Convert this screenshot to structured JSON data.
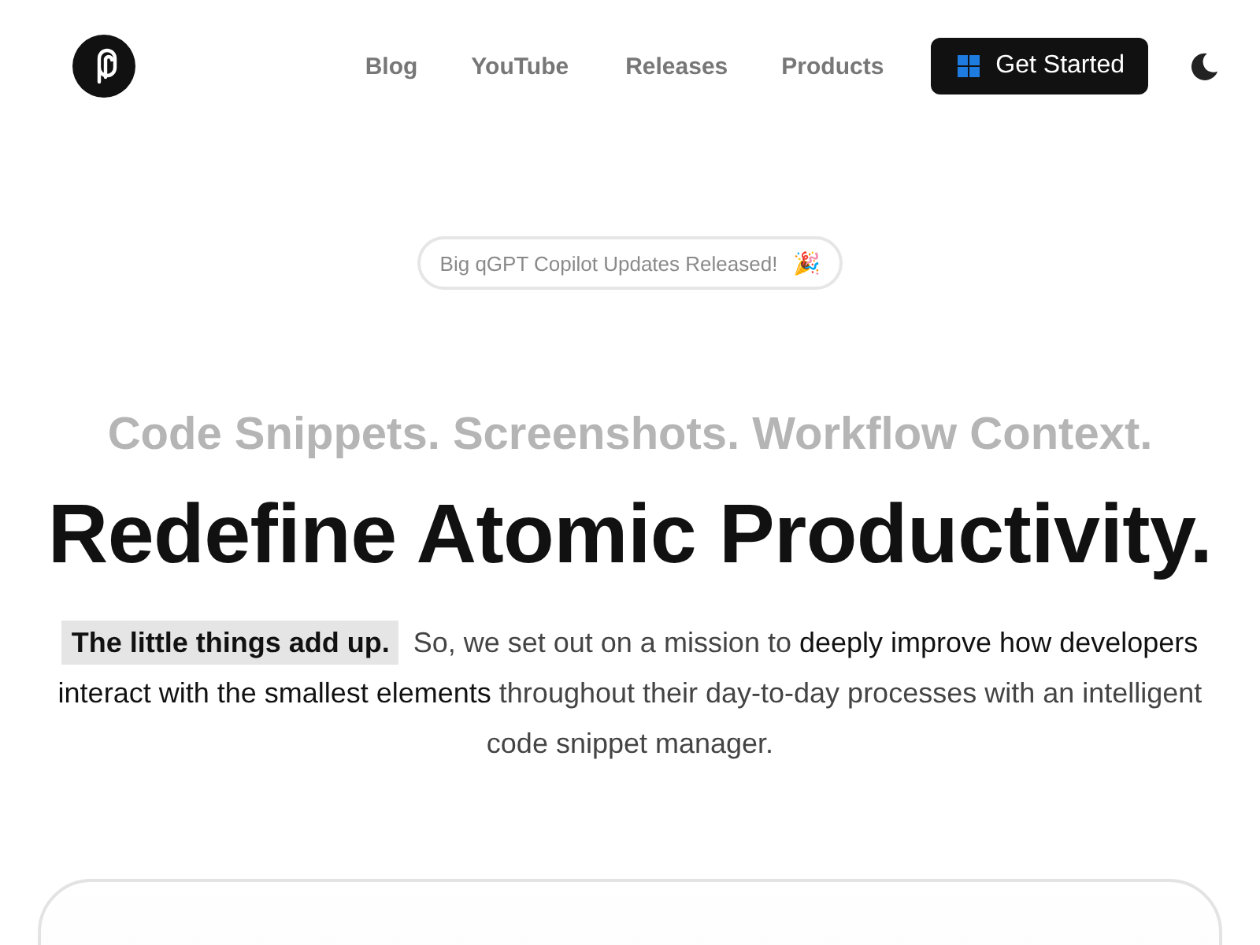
{
  "nav": {
    "links": [
      "Blog",
      "YouTube",
      "Releases",
      "Products"
    ],
    "cta": "Get Started"
  },
  "announcement": {
    "text": "Big qGPT Copilot Updates Released!",
    "emoji": "🎉"
  },
  "hero": {
    "kicker": "Code Snippets. Screenshots. Workflow Context.",
    "title": "Redefine Atomic Productivity.",
    "description": "**The little things add up.** So, we set out on a mission to **deeply improve how developers interact with the smallest elements** throughout their day-to-day processes with an intelligent code snippet manager."
  }
}
